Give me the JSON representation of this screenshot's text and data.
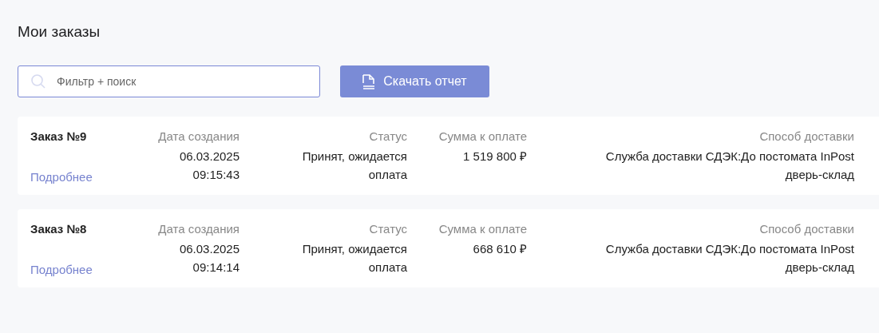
{
  "page_title": "Мои заказы",
  "search": {
    "placeholder": "Фильтр + поиск"
  },
  "download_button": {
    "label": "Скачать отчет"
  },
  "orders": [
    {
      "title": "Заказ №9",
      "details_link": "Подробнее",
      "date_label": "Дата создания",
      "date": "06.03.2025",
      "time": "09:15:43",
      "status_label": "Статус",
      "status": "Принят, ожидается оплата",
      "sum_label": "Сумма к оплате",
      "sum": "1 519 800 ₽",
      "delivery_label": "Способ доставки",
      "delivery": "Служба доставки СДЭК:До постомата InPost дверь-склад"
    },
    {
      "title": "Заказ №8",
      "details_link": "Подробнее",
      "date_label": "Дата создания",
      "date": "06.03.2025",
      "time": "09:14:14",
      "status_label": "Статус",
      "status": "Принят, ожидается оплата",
      "sum_label": "Сумма к оплате",
      "sum": "668 610 ₽",
      "delivery_label": "Способ доставки",
      "delivery": "Служба доставки СДЭК:До постомата InPost дверь-склад"
    }
  ]
}
